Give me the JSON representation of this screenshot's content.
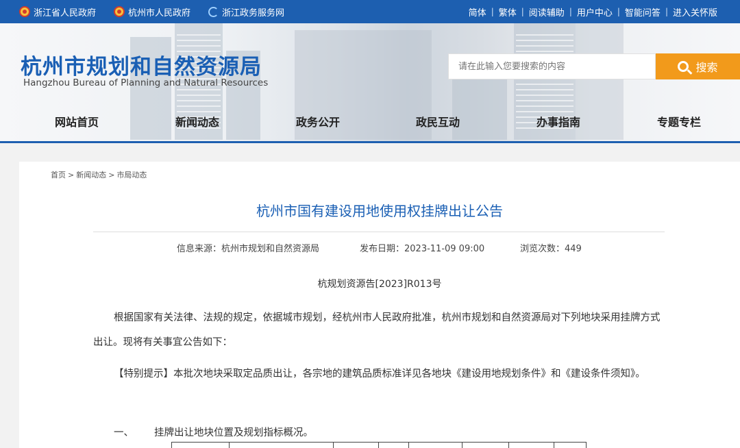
{
  "topbar": {
    "links": [
      "浙江省人民政府",
      "杭州市人民政府",
      "浙江政务服务网"
    ],
    "right_links": [
      "简体",
      "繁体",
      "阅读辅助",
      "用户中心",
      "智能问答",
      "进入关怀版"
    ]
  },
  "header": {
    "logo_cn": "杭州市规划和自然资源局",
    "logo_en": "Hangzhou Bureau of Planning and Natural Resources",
    "search_placeholder": "请在此输入您要搜索的内容",
    "search_label": "搜索"
  },
  "nav": [
    "网站首页",
    "新闻动态",
    "政务公开",
    "政民互动",
    "办事指南",
    "专题专栏"
  ],
  "breadcrumb": [
    "首页",
    "新闻动态",
    "市局动态"
  ],
  "article": {
    "title": "杭州市国有建设用地使用权挂牌出让公告",
    "source": "信息来源：杭州市规划和自然资源局",
    "date": "发布日期：2023-11-09 09:00",
    "views": "浏览次数：449",
    "doc_no": "杭规划资源告[2023]R013号",
    "p1": "根据国家有关法律、法规的规定，依据城市规划，经杭州市人民政府批准，杭州市规划和自然资源局对下列地块采用挂牌方式出让。现将有关事宜公告如下：",
    "p2": "【特别提示】本批次地块采取定品质出让，各宗地的建筑品质标准详见各地块《建设用地规划条件》和《建设条件须知》。",
    "section_num": "一、",
    "section_title": "挂牌出让地块位置及规划指标概况。"
  },
  "colors": {
    "primary": "#1d5fb0",
    "accent": "#f29a1b"
  }
}
